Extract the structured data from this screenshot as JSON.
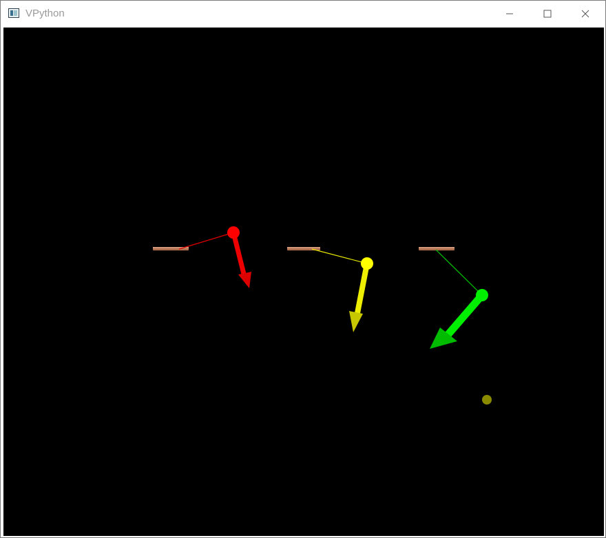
{
  "window": {
    "title": "VPython",
    "icon": "vpython-app-icon",
    "controls": [
      "minimize-icon",
      "maximize-icon",
      "close-icon"
    ]
  },
  "scene": {
    "background_color": "#000000",
    "pendulums": [
      {
        "color": "#ff0000",
        "name": "red"
      },
      {
        "color": "#ffff00",
        "name": "yellow"
      },
      {
        "color": "#00dd00",
        "name": "green"
      }
    ],
    "support_color": "#b07050",
    "marker_color": "#8a8a00"
  }
}
